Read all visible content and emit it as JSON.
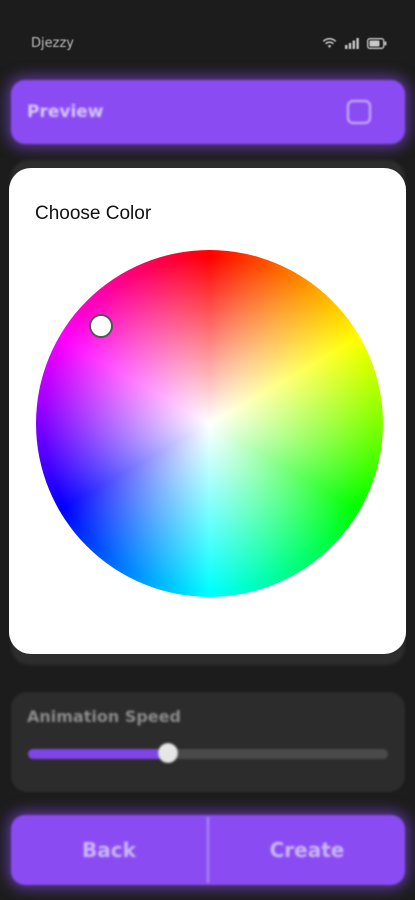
{
  "status_bar": {
    "carrier": "Djezzy",
    "icons": [
      "wifi-icon",
      "signal-icon",
      "battery-icon"
    ]
  },
  "preview": {
    "label": "Preview",
    "toggle_icon": "checkbox-square-icon",
    "checked": false
  },
  "color_dialog": {
    "title": "Choose Color"
  },
  "animation_speed": {
    "label": "Animation Speed",
    "value_fraction": 0.39
  },
  "buttons": {
    "back_label": "Back",
    "create_label": "Create"
  },
  "colors": {
    "accent": "#8a4cf2",
    "background": "#1c1c1c",
    "card": "#2c2c2c",
    "dialog": "#ffffff"
  }
}
